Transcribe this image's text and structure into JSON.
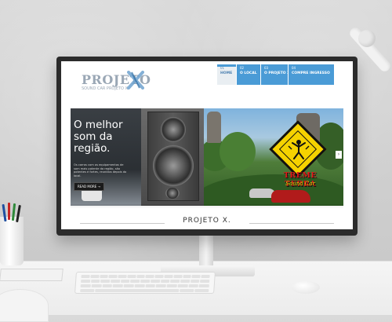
{
  "site": {
    "logo": {
      "text": "PROJETO",
      "sub": "SOUND CAR      PROJETO X"
    },
    "nav": [
      {
        "num": "01",
        "label": "HOME",
        "active": true
      },
      {
        "num": "02",
        "label": "O LOCAL",
        "active": false
      },
      {
        "num": "03",
        "label": "O PROJETO X",
        "active": false
      },
      {
        "num": "04",
        "label": "COMPRE INGRESSO",
        "active": false
      }
    ],
    "hero": {
      "title": "O melhor som da região.",
      "description": "Os carros com os equipamentos de som mais potente da região, são potentes e fortes, reunidos depois do local.",
      "read_more": "READ MORE  →",
      "sign_title": "TREME TERRA",
      "sign_subtitle": "Sound Car",
      "arrow": "›"
    },
    "footer_title": "PROJETO X."
  },
  "colors": {
    "nav_blue": "#4a9bd6",
    "title_red": "#e01818",
    "sign_yellow": "#f5d200"
  }
}
